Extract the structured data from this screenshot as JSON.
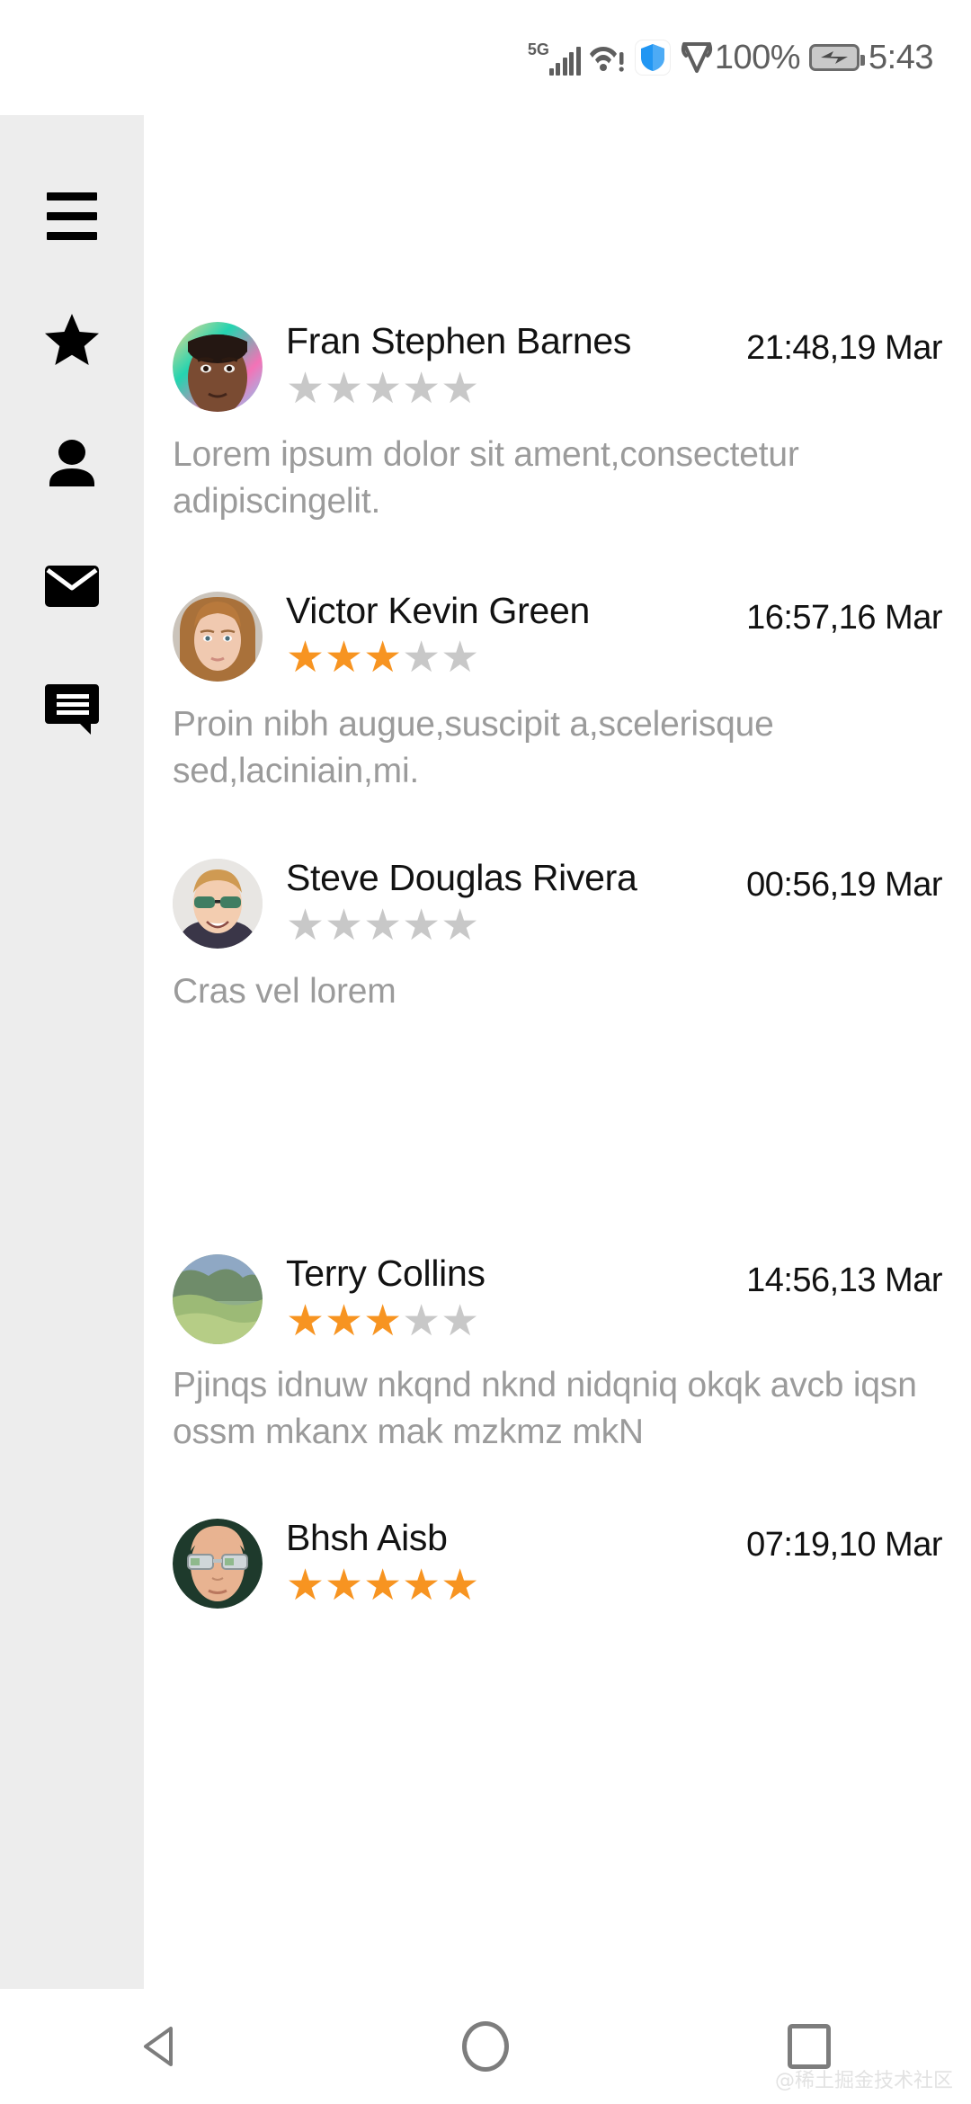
{
  "status_bar": {
    "network_label": "5G",
    "signal_icon": "signal-bars-icon",
    "wifi_icon": "wifi-warning-icon",
    "shield_icon": "shield-icon",
    "gem_icon": "gem-outline-icon",
    "battery_percent": "100%",
    "battery_icon": "battery-charging-icon",
    "time": "5:43",
    "shield_color": "#2196f3"
  },
  "sidebar": {
    "items": [
      {
        "name": "menu",
        "icon": "hamburger-menu-icon"
      },
      {
        "name": "favorites",
        "icon": "star-icon"
      },
      {
        "name": "profile",
        "icon": "person-icon"
      },
      {
        "name": "mail",
        "icon": "mail-icon"
      },
      {
        "name": "comments",
        "icon": "chat-bubble-icon"
      }
    ],
    "background": "#ededed"
  },
  "reviews": [
    {
      "name": "Fran Stephen Barnes",
      "time": "21:48,19 Mar",
      "rating": 0,
      "max_rating": 5,
      "text": "Lorem ipsum dolor sit ament,consectetur adipiscingelit.",
      "avatar": "avatar-fran"
    },
    {
      "name": "Victor Kevin Green",
      "time": "16:57,16 Mar",
      "rating": 3,
      "max_rating": 5,
      "text": "Proin nibh augue,suscipit a,scelerisque sed,laciniain,mi.",
      "avatar": "avatar-victor"
    },
    {
      "name": "Steve Douglas Rivera",
      "time": "00:56,19 Mar",
      "rating": 0,
      "max_rating": 5,
      "text": "Cras vel lorem",
      "avatar": "avatar-steve"
    },
    {
      "name": "Terry Collins",
      "time": "14:56,13 Mar",
      "rating": 3,
      "max_rating": 5,
      "text": "Pjinqs idnuw nkqnd nknd nidqniq okqk avcb iqsn ossm mkanx mak mzkmz mkN",
      "avatar": "avatar-terry"
    },
    {
      "name": "Bhsh Aisb",
      "time": "07:19,10 Mar",
      "rating": 5,
      "max_rating": 5,
      "text": "",
      "avatar": "avatar-bhsh"
    }
  ],
  "nav_bar": {
    "back": "back-triangle-icon",
    "home": "home-circle-icon",
    "recents": "recents-square-icon"
  },
  "watermark": "@稀土掘金技术社区",
  "colors": {
    "star_filled": "#f79421",
    "star_empty": "#c8c8c8",
    "body_text": "#9b9b9b",
    "name_text": "#121212"
  }
}
